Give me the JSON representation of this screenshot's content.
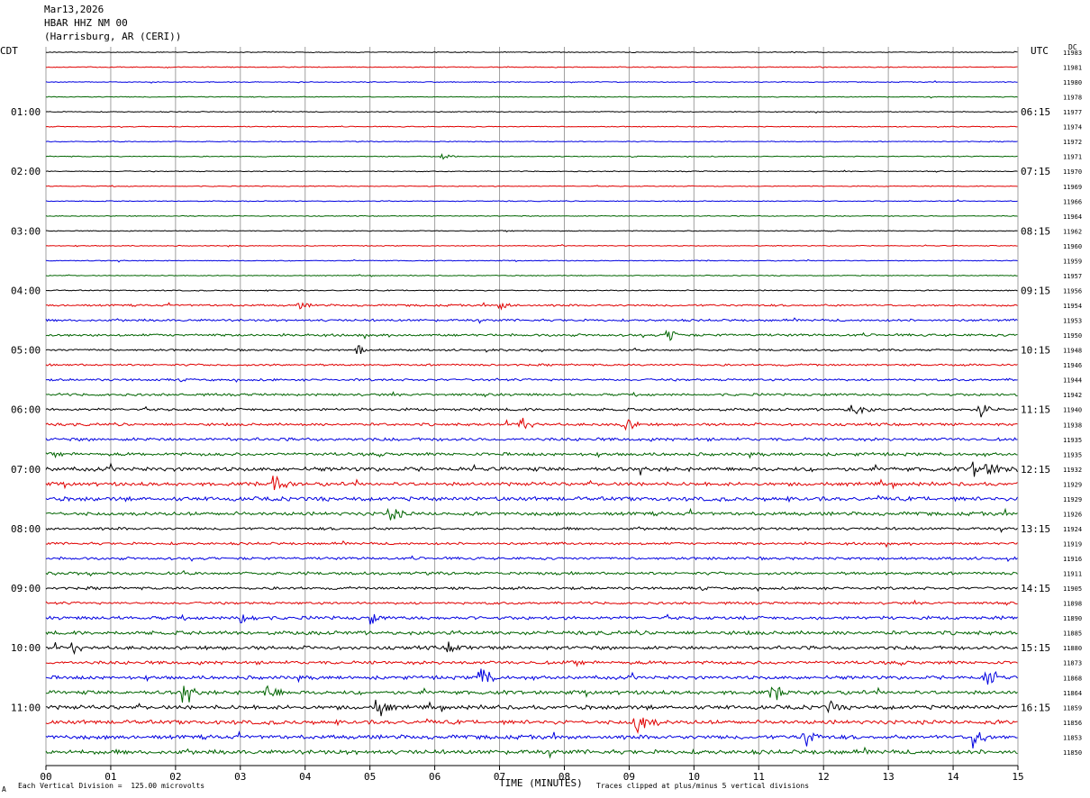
{
  "header": {
    "date": "Mar13,2026",
    "station": "HBAR HHZ NM 00",
    "location": "(Harrisburg, AR (CERI))"
  },
  "left_tz": "CDT",
  "right_tz": "UTC",
  "dc_label": "DC",
  "footer": {
    "scale_note": "Each Vertical Division =  125.00 microvolts",
    "xlabel": "TIME (MINUTES)",
    "clip_note": "Traces clipped at plus/minus 5 vertical divisions",
    "corner_mark": "A"
  },
  "colors": {
    "black": "#000000",
    "red": "#e00000",
    "blue": "#0000e0",
    "green": "#006400",
    "grid": "#a0a0a0"
  },
  "chart_data": {
    "type": "line",
    "title": "HBAR HHZ NM 00",
    "xlabel": "TIME (MINUTES)",
    "xlim": [
      0,
      15
    ],
    "x_ticks": [
      "00",
      "01",
      "02",
      "03",
      "04",
      "05",
      "06",
      "07",
      "08",
      "09",
      "10",
      "11",
      "12",
      "13",
      "14",
      "15"
    ],
    "trace_color_cycle": [
      "black",
      "red",
      "blue",
      "green"
    ],
    "trace_count": 48,
    "left_hour_labels": [
      "01:00",
      "02:00",
      "03:00",
      "04:00",
      "05:00",
      "06:00",
      "07:00",
      "08:00",
      "09:00",
      "10:00",
      "11:00"
    ],
    "right_hour_labels": [
      "06:15",
      "07:15",
      "08:15",
      "09:15",
      "10:15",
      "11:15",
      "12:15",
      "13:15",
      "14:15",
      "15:15",
      "16:15"
    ],
    "dc_offsets": [
      "11983",
      "11981",
      "11980",
      "11978",
      "11977",
      "11974",
      "11972",
      "11971",
      "11970",
      "11969",
      "11966",
      "11964",
      "11962",
      "11960",
      "11959",
      "11957",
      "11956",
      "11954",
      "11953",
      "11950",
      "11948",
      "11946",
      "11944",
      "11942",
      "11940",
      "11938",
      "11935",
      "11935",
      "11932",
      "11929",
      "11929",
      "11926",
      "11924",
      "11919",
      "11916",
      "11911",
      "11905",
      "11898",
      "11890",
      "11885",
      "11880",
      "11873",
      "11868",
      "11864",
      "11859",
      "11856",
      "11853",
      "11850"
    ],
    "noise_level": [
      0.4,
      0.4,
      0.4,
      0.4,
      0.4,
      0.4,
      0.4,
      0.4,
      0.4,
      0.4,
      0.4,
      0.4,
      0.4,
      0.4,
      0.4,
      0.4,
      0.5,
      0.9,
      1.0,
      1.1,
      0.9,
      0.9,
      1.0,
      1.1,
      1.2,
      1.2,
      1.4,
      1.4,
      1.8,
      1.6,
      1.8,
      1.6,
      1.2,
      1.1,
      1.2,
      1.3,
      1.2,
      1.1,
      1.5,
      1.7,
      1.6,
      1.5,
      1.6,
      1.7,
      1.8,
      1.8,
      1.8,
      1.9
    ],
    "events": [
      {
        "trace": 7,
        "minute": 6.1,
        "amp": 3,
        "dur": 0.3
      },
      {
        "trace": 17,
        "minute": 3.9,
        "amp": 4,
        "dur": 0.3
      },
      {
        "trace": 17,
        "minute": 7.0,
        "amp": 5,
        "dur": 0.3
      },
      {
        "trace": 19,
        "minute": 9.6,
        "amp": 10,
        "dur": 0.3
      },
      {
        "trace": 20,
        "minute": 4.8,
        "amp": 8,
        "dur": 0.2
      },
      {
        "trace": 24,
        "minute": 12.4,
        "amp": 9,
        "dur": 0.4
      },
      {
        "trace": 24,
        "minute": 14.4,
        "amp": 12,
        "dur": 0.3
      },
      {
        "trace": 25,
        "minute": 7.3,
        "amp": 12,
        "dur": 0.3
      },
      {
        "trace": 25,
        "minute": 8.9,
        "amp": 12,
        "dur": 0.3
      },
      {
        "trace": 28,
        "minute": 14.3,
        "amp": 9,
        "dur": 1.0
      },
      {
        "trace": 29,
        "minute": 3.5,
        "amp": 14,
        "dur": 0.3
      },
      {
        "trace": 31,
        "minute": 5.3,
        "amp": 10,
        "dur": 0.3
      },
      {
        "trace": 38,
        "minute": 3.0,
        "amp": 10,
        "dur": 0.3
      },
      {
        "trace": 38,
        "minute": 5.0,
        "amp": 9,
        "dur": 0.2
      },
      {
        "trace": 40,
        "minute": 0.4,
        "amp": 12,
        "dur": 0.2
      },
      {
        "trace": 40,
        "minute": 6.2,
        "amp": 8,
        "dur": 0.3
      },
      {
        "trace": 42,
        "minute": 6.7,
        "amp": 18,
        "dur": 0.3
      },
      {
        "trace": 42,
        "minute": 14.5,
        "amp": 16,
        "dur": 0.3
      },
      {
        "trace": 43,
        "minute": 2.1,
        "amp": 14,
        "dur": 0.3
      },
      {
        "trace": 43,
        "minute": 3.4,
        "amp": 14,
        "dur": 0.3
      },
      {
        "trace": 43,
        "minute": 11.2,
        "amp": 14,
        "dur": 0.3
      },
      {
        "trace": 44,
        "minute": 5.1,
        "amp": 16,
        "dur": 0.3
      },
      {
        "trace": 44,
        "minute": 12.1,
        "amp": 10,
        "dur": 0.2
      },
      {
        "trace": 45,
        "minute": 9.1,
        "amp": 16,
        "dur": 0.4
      },
      {
        "trace": 46,
        "minute": 11.7,
        "amp": 14,
        "dur": 0.3
      },
      {
        "trace": 46,
        "minute": 14.3,
        "amp": 14,
        "dur": 0.3
      }
    ]
  }
}
